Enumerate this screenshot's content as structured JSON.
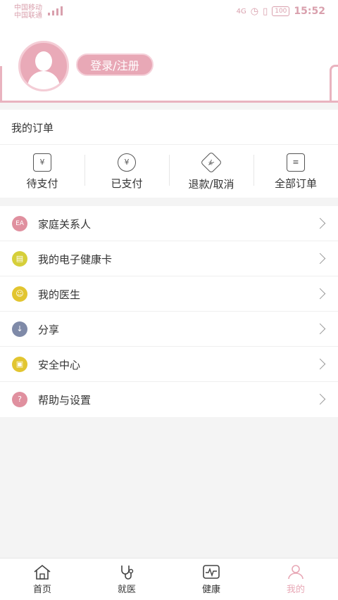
{
  "status_bar": {
    "carrier1": "中国移动",
    "carrier2": "中国联通",
    "network": "4G",
    "battery": "100",
    "time": "15:52"
  },
  "profile": {
    "login_label": "登录/注册"
  },
  "orders": {
    "title": "我的订单",
    "items": [
      {
        "label": "待支付",
        "icon": "pending-payment-icon",
        "glyph": "¥"
      },
      {
        "label": "已支付",
        "icon": "paid-icon",
        "glyph": "¥"
      },
      {
        "label": "退款/取消",
        "icon": "refund-icon",
        "glyph": "¥"
      },
      {
        "label": "全部订单",
        "icon": "all-orders-icon",
        "glyph": "≡"
      }
    ]
  },
  "menu": {
    "items": [
      {
        "label": "家庭关系人",
        "icon": "family-contacts-icon",
        "glyph": "EA",
        "color": "#e0909f"
      },
      {
        "label": "我的电子健康卡",
        "icon": "health-card-icon",
        "glyph": "▤",
        "color": "#d6cf3a"
      },
      {
        "label": "我的医生",
        "icon": "doctor-icon",
        "glyph": "☺",
        "color": "#e2c530"
      },
      {
        "label": "分享",
        "icon": "share-icon",
        "glyph": "↓",
        "color": "#7f8aa8"
      },
      {
        "label": "安全中心",
        "icon": "lock-icon",
        "glyph": "▣",
        "color": "#e2c530"
      },
      {
        "label": "帮助与设置",
        "icon": "help-icon",
        "glyph": "?",
        "color": "#e0909f"
      }
    ]
  },
  "tabbar": {
    "items": [
      {
        "label": "首页",
        "icon": "home-icon"
      },
      {
        "label": "就医",
        "icon": "stethoscope-icon"
      },
      {
        "label": "健康",
        "icon": "health-monitor-icon"
      },
      {
        "label": "我的",
        "icon": "profile-icon"
      }
    ],
    "active_color": "#e8a8b6"
  }
}
